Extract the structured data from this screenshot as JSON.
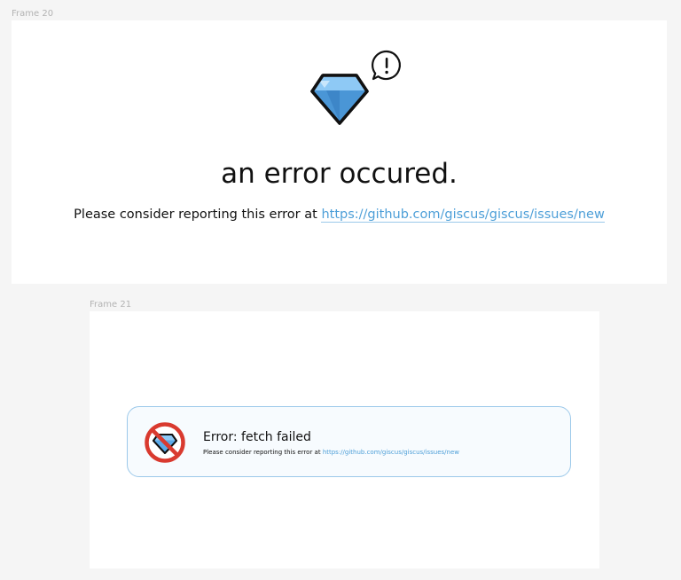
{
  "frame20": {
    "label": "Frame 20",
    "title": "an error occured.",
    "message_prefix": "Please consider reporting this error at ",
    "link_text": "https://github.com/giscus/giscus/issues/new",
    "icons": [
      "gem-icon",
      "speech-bubble-exclamation-icon"
    ]
  },
  "frame21": {
    "label": "Frame 21",
    "title": "Error: fetch failed",
    "message_prefix": "Please consider reporting this error at ",
    "link_text": "https://github.com/giscus/giscus/issues/new",
    "icons": [
      "no-gem-icon"
    ]
  },
  "colors": {
    "canvas": "#f5f5f5",
    "frame": "#ffffff",
    "link": "#4d9fd8",
    "card_border": "#9cc9ea",
    "card_bg": "#f7fbfe",
    "prohibit_red": "#d93a2f",
    "gem_blue": "#5aa9e8"
  }
}
